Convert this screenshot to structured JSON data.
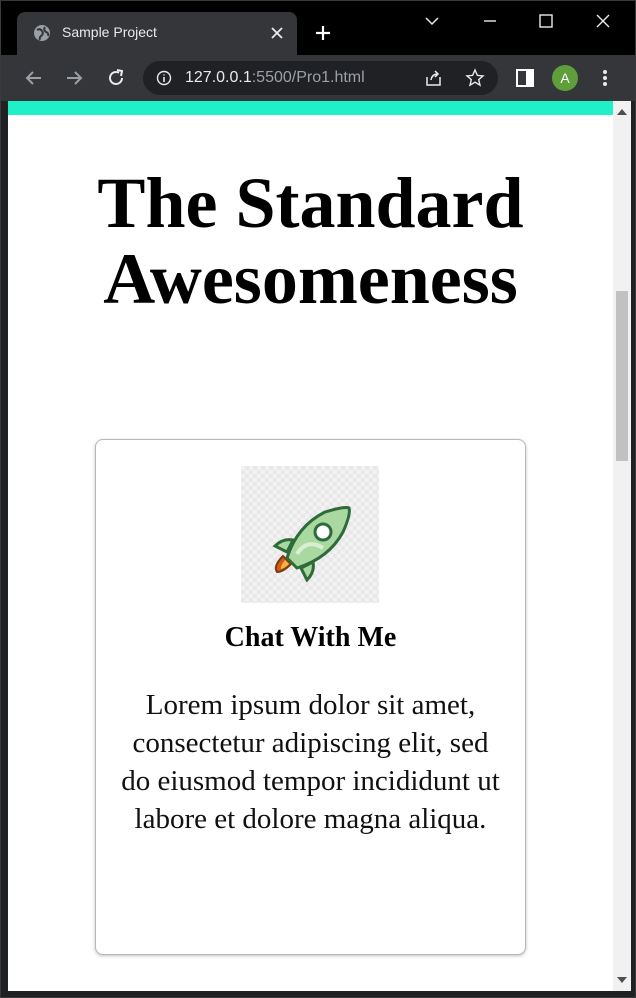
{
  "browser": {
    "tab_title": "Sample Project",
    "url_host": "127.0.0.1",
    "url_rest": ":5500/Pro1.html",
    "avatar_letter": "A",
    "icons": [
      "globe-icon",
      "close-icon",
      "plus-icon",
      "chevron-down-icon",
      "minimize-icon",
      "maximize-icon",
      "window-close-icon",
      "back-arrow-icon",
      "forward-arrow-icon",
      "reload-icon",
      "info-icon",
      "share-icon",
      "star-icon",
      "sidepanel-icon",
      "kebab-menu-icon"
    ]
  },
  "page": {
    "accent_color": "#1ff0c8",
    "title_line1": "The Standard",
    "title_line2": "Awesomeness",
    "card": {
      "image_icon": "rocket-icon",
      "title": "Chat With Me",
      "text": "Lorem ipsum dolor sit amet, consectetur adipiscing elit, sed do eiusmod tempor incididunt ut labore et dolore magna aliqua."
    }
  }
}
